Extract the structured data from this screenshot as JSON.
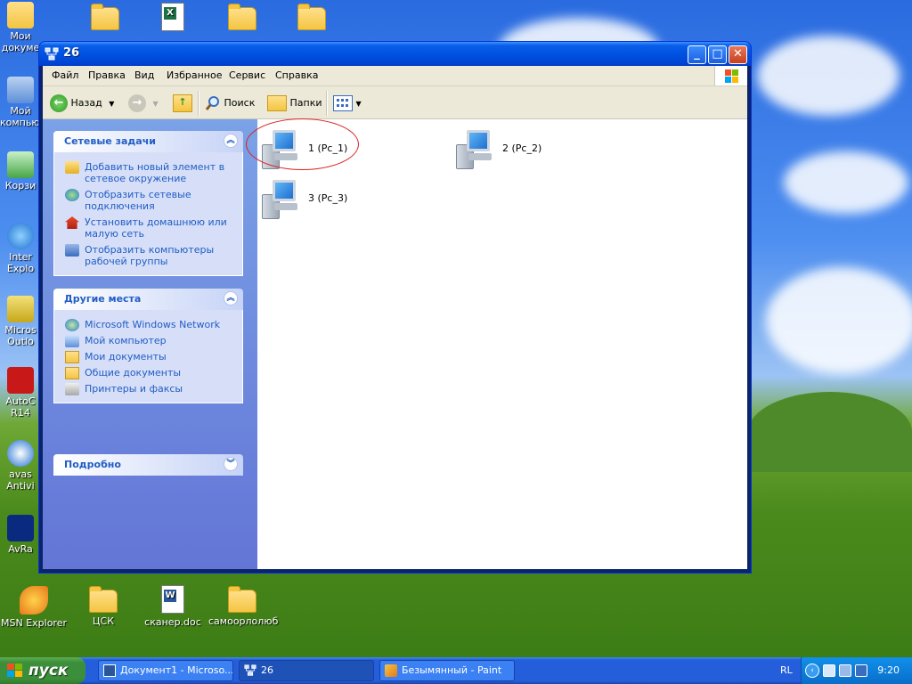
{
  "desktop": {
    "left_column": [
      {
        "label": "Мои докуме",
        "icon": "my-documents-icon"
      },
      {
        "label": "Мой компьют",
        "icon": "my-computer-icon"
      },
      {
        "label": "Корзи",
        "icon": "recycle-bin-icon"
      },
      {
        "label": "Inter Explo",
        "icon": "internet-explorer-icon"
      },
      {
        "label": "Micros Outlo",
        "icon": "outlook-icon"
      },
      {
        "label": "AutoC R14",
        "icon": "autocad-icon"
      },
      {
        "label": "avas Antivi",
        "icon": "avast-icon"
      },
      {
        "label": "AvRa",
        "icon": "avra-icon"
      }
    ],
    "bottom_icons": [
      {
        "label": "MSN Explorer",
        "icon": "msn-explorer-icon"
      },
      {
        "label": "ЦСК",
        "icon": "folder-icon"
      },
      {
        "label": "сканер.doc",
        "icon": "word-document-icon"
      },
      {
        "label": "самоорлолюб",
        "icon": "folder-icon"
      }
    ]
  },
  "window": {
    "title": "26",
    "menu": [
      "Файл",
      "Правка",
      "Вид",
      "Избранное",
      "Сервис",
      "Справка"
    ],
    "toolbar": {
      "back": "Назад",
      "search": "Поиск",
      "folders": "Папки"
    },
    "panels": {
      "network_tasks": {
        "title": "Сетевые задачи",
        "items": [
          "Добавить новый элемент в сетевое окружение",
          "Отобразить сетевые подключения",
          "Установить домашнюю или малую сеть",
          "Отобразить компьютеры рабочей группы"
        ]
      },
      "other_places": {
        "title": "Другие места",
        "items": [
          "Microsoft Windows Network",
          "Мой компьютер",
          "Мои документы",
          "Общие документы",
          "Принтеры и факсы"
        ]
      },
      "details": {
        "title": "Подробно"
      }
    },
    "computers": [
      {
        "label": "1 (Pc_1)"
      },
      {
        "label": "2 (Pc_2)"
      },
      {
        "label": "3 (Pc_3)"
      }
    ]
  },
  "taskbar": {
    "start": "пуск",
    "tasks": [
      {
        "label": "Документ1 - Microso..."
      },
      {
        "label": "26"
      },
      {
        "label": "Безымянный - Paint"
      }
    ],
    "lang": "RL",
    "clock": "9:20"
  },
  "colors": {
    "accent": "#0052e2",
    "link": "#215dc6",
    "start_green": "#3c8f3a"
  }
}
